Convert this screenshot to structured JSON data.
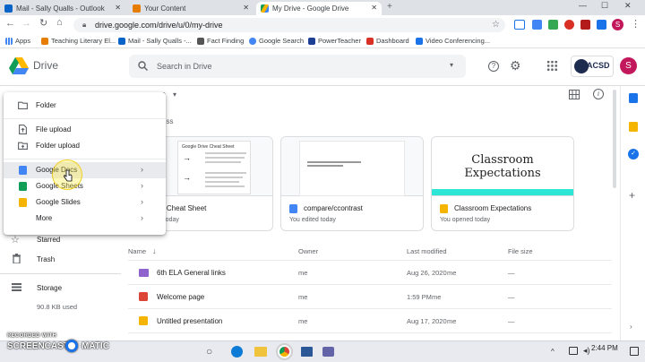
{
  "browser": {
    "tabs": [
      {
        "label": "Mail - Sally Qualls - Outlook",
        "active": false
      },
      {
        "label": "Your Content",
        "active": false
      },
      {
        "label": "My Drive - Google Drive",
        "active": true
      }
    ],
    "url": "drive.google.com/drive/u/0/my-drive",
    "bookmarks": [
      "Apps",
      "Teaching Literary El...",
      "Mail - Sally Qualls -...",
      "Fact Finding",
      "Google Search",
      "PowerTeacher",
      "Dashboard",
      "Video Conferencing..."
    ],
    "profile_initial": "S"
  },
  "drive": {
    "app_name": "Drive",
    "search_placeholder": "Search in Drive",
    "account_badge": "ACSD",
    "account_initial": "S",
    "breadcrumb_fragment": "e",
    "quick_access_fragment": "ess"
  },
  "new_menu": {
    "items": [
      {
        "label": "Folder",
        "icon": "folder-plus-icon",
        "submenu": false
      },
      {
        "label": "File upload",
        "icon": "file-upload-icon",
        "submenu": false
      },
      {
        "label": "Folder upload",
        "icon": "folder-upload-icon",
        "submenu": false
      },
      {
        "label": "Google Docs",
        "icon": "google-docs-icon",
        "submenu": true,
        "highlighted": true
      },
      {
        "label": "Google Sheets",
        "icon": "google-sheets-icon",
        "submenu": true
      },
      {
        "label": "Google Slides",
        "icon": "google-slides-icon",
        "submenu": true
      },
      {
        "label": "More",
        "icon": "",
        "submenu": true
      }
    ]
  },
  "sidebar": {
    "starred": "Starred",
    "trash": "Trash",
    "storage": "Storage",
    "storage_used": "90.8 KB used"
  },
  "quick_access": [
    {
      "title": "gle Cheat Sheet",
      "subtitle": "ed today",
      "thumb_heading": "Google Drive Cheat Sheet",
      "type": "docs"
    },
    {
      "title": "compare/ccontrast",
      "subtitle": "You edited today",
      "type": "docs"
    },
    {
      "title": "Classroom Expectations",
      "subtitle": "You opened today",
      "thumb_heading": "Classroom Expectations",
      "type": "slides"
    }
  ],
  "files": {
    "columns": {
      "name": "Name",
      "owner": "Owner",
      "modified": "Last modified",
      "size": "File size"
    },
    "rows": [
      {
        "name": "6th ELA General links",
        "type": "shared-folder",
        "owner": "me",
        "modified": "Aug 26, 2020",
        "modified_by": "me",
        "size": "—"
      },
      {
        "name": "Welcome page",
        "type": "site",
        "owner": "me",
        "modified": "1:59 PM",
        "modified_by": "me",
        "size": "—"
      },
      {
        "name": "Untitled presentation",
        "type": "slides",
        "owner": "me",
        "modified": "Aug 17, 2020",
        "modified_by": "me",
        "size": "—"
      }
    ]
  },
  "watermark": {
    "line1": "RECORDED WITH",
    "line2": "SCREENCAST",
    "line3": "MATIC"
  },
  "taskbar": {
    "time": "2:44 PM"
  },
  "colors": {
    "docs": "#4285f4",
    "sheets": "#0f9d58",
    "slides": "#f4b400",
    "site": "#db4437",
    "folder": "#8e63ce",
    "accent_bar": "#2ee6d6"
  }
}
